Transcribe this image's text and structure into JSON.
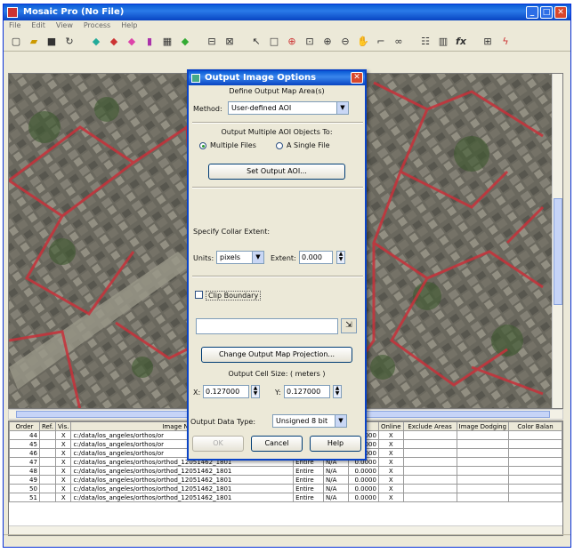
{
  "app": {
    "title": "Mosaic Pro (No File)",
    "menus": [
      "File",
      "Edit",
      "View",
      "Process",
      "Help"
    ]
  },
  "toolbar_icons": [
    "new-icon",
    "open-icon",
    "save-icon",
    "refresh-icon",
    "layer-add-icon",
    "layer-remove-icon",
    "layer-color-icon",
    "layer-purple-icon",
    "grid-icon",
    "layer-green-icon",
    "fit-icon",
    "display-icon",
    "arrow-icon",
    "select-box-icon",
    "target-icon",
    "zoom-fit-icon",
    "zoom-in-icon",
    "zoom-out-icon",
    "pan-icon",
    "measure-icon",
    "link-icon",
    "properties-icon",
    "chart-icon",
    "function-icon",
    "output-icon",
    "run-icon"
  ],
  "dialog": {
    "title": "Output Image Options",
    "subtitle": "Define Output Map Area(s)",
    "method_label": "Method:",
    "method_value": "User-defined AOI",
    "multi_aoi_label": "Output Multiple AOI Objects To:",
    "radio_multiple": "Multiple Files",
    "radio_single": "A Single File",
    "set_aoi_button": "Set Output AOI...",
    "collar_label": "Specify Collar Extent:",
    "units_label": "Units:",
    "units_value": "pixels",
    "extent_label": "Extent:",
    "extent_value": "0.000",
    "clip_label": "Clip Boundary",
    "clip_path": "",
    "change_proj_button": "Change Output Map Projection...",
    "cell_size_label": "Output Cell Size: ( meters )",
    "x_label": "X:",
    "x_value": "0.127000",
    "y_label": "Y:",
    "y_value": "0.127000",
    "data_type_label": "Output Data Type:",
    "data_type_value": "Unsigned 8 bit",
    "ok_button": "OK",
    "cancel_button": "Cancel",
    "help_button": "Help"
  },
  "table": {
    "headers": [
      "Order",
      "Ref.",
      "Vis.",
      "Image Name",
      "",
      "",
      "",
      "Online",
      "Exclude Areas",
      "Image Dodging",
      "Color Balan"
    ],
    "rows": [
      {
        "order": "44",
        "vis": "X",
        "name": "c:/data/los_angeles/orthos/or",
        "c1": "",
        "c2": "",
        "c3": "0.0000",
        "online": "X"
      },
      {
        "order": "45",
        "vis": "X",
        "name": "c:/data/los_angeles/orthos/or",
        "c1": "",
        "c2": "",
        "c3": "0.0000",
        "online": "X"
      },
      {
        "order": "46",
        "vis": "X",
        "name": "c:/data/los_angeles/orthos/or",
        "c1": "",
        "c2": "",
        "c3": "0.0000",
        "online": "X"
      },
      {
        "order": "47",
        "vis": "X",
        "name": "c:/data/los_angeles/orthos/orthod_12051462_1801",
        "c1": "Entire",
        "c2": "N/A",
        "c3": "0.0000",
        "online": "X"
      },
      {
        "order": "48",
        "vis": "X",
        "name": "c:/data/los_angeles/orthos/orthod_12051462_1801",
        "c1": "Entire",
        "c2": "N/A",
        "c3": "0.0000",
        "online": "X"
      },
      {
        "order": "49",
        "vis": "X",
        "name": "c:/data/los_angeles/orthos/orthod_12051462_1801",
        "c1": "Entire",
        "c2": "N/A",
        "c3": "0.0000",
        "online": "X"
      },
      {
        "order": "50",
        "vis": "X",
        "name": "c:/data/los_angeles/orthos/orthod_12051462_1801",
        "c1": "Entire",
        "c2": "N/A",
        "c3": "0.0000",
        "online": "X"
      },
      {
        "order": "51",
        "vis": "X",
        "name": "c:/data/los_angeles/orthos/orthod_12051462_1801",
        "c1": "Entire",
        "c2": "N/A",
        "c3": "0.0000",
        "online": "X"
      }
    ]
  }
}
